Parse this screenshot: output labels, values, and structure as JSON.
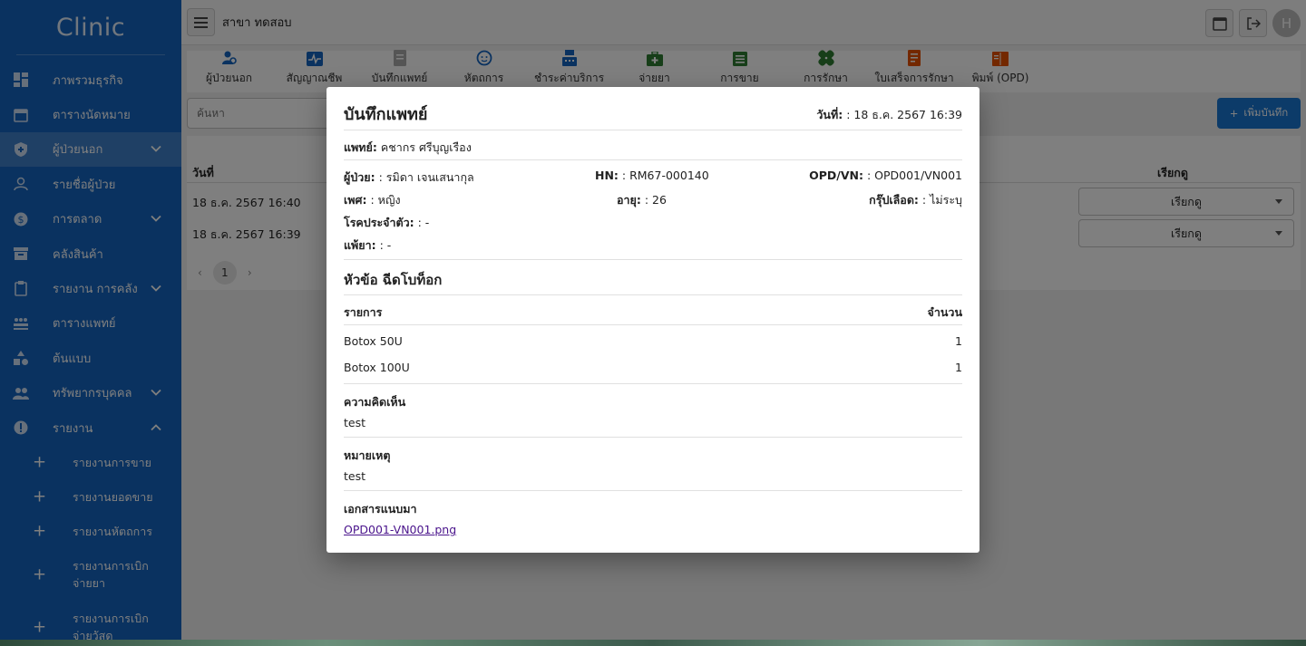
{
  "sidebar": {
    "brand": "Clinic",
    "items": [
      {
        "label": "ภาพรวมธุรกิจ",
        "icon": "dashboard-icon"
      },
      {
        "label": "ตารางนัดหมาย",
        "icon": "calendar-icon"
      },
      {
        "label": "ผู้ป่วยนอก",
        "icon": "shield-icon"
      },
      {
        "label": "รายชื่อผู้ป่วย",
        "icon": "people-icon"
      },
      {
        "label": "การตลาด",
        "icon": "dollar-icon"
      },
      {
        "label": "คลังสินค้า",
        "icon": "archive-icon"
      },
      {
        "label": "รายงาน การคลัง",
        "icon": "clipboard-icon"
      },
      {
        "label": "ตารางแพทย์",
        "icon": "group-icon"
      },
      {
        "label": "ต้นแบบ",
        "icon": "shapes-icon"
      },
      {
        "label": "ทรัพยากรบุคคล",
        "icon": "team-icon"
      },
      {
        "label": "รายงาน",
        "icon": "info-icon"
      }
    ],
    "sub_items": [
      {
        "label": "รายงานการขาย"
      },
      {
        "label": "รายงานยอดขาย"
      },
      {
        "label": "รายงานหัตถการ"
      },
      {
        "label": "รายงานการเบิกจ่ายยา"
      },
      {
        "label": "รายงานการเบิกจ่ายวัสดุ"
      }
    ]
  },
  "topbar": {
    "branch": "สาขา ทดสอบ",
    "avatar": "H"
  },
  "tabs": [
    {
      "label": "ผู้ป่วยนอก",
      "icon": "patient-search-icon",
      "color": "#1565c0"
    },
    {
      "label": "สัญญาณชีพ",
      "icon": "vitals-icon",
      "color": "#1565c0"
    },
    {
      "label": "บันทึกแพทย์",
      "icon": "doctor-note-icon",
      "color": "#aaaaaa"
    },
    {
      "label": "หัตถการ",
      "icon": "face-icon",
      "color": "#1565c0"
    },
    {
      "label": "ชำระค่าบริการ",
      "icon": "cashier-icon",
      "color": "#1565c0"
    },
    {
      "label": "จ่ายยา",
      "icon": "medkit-icon",
      "color": "#2e7d32"
    },
    {
      "label": "การขาย",
      "icon": "sales-icon",
      "color": "#2e7d32"
    },
    {
      "label": "การรักษา",
      "icon": "bandage-icon",
      "color": "#2e7d32"
    },
    {
      "label": "ใบเสร็จการรักษา",
      "icon": "receipt-icon",
      "color": "#e65100"
    },
    {
      "label": "พิมพ์ (OPD)",
      "icon": "book-icon",
      "color": "#e65100"
    }
  ],
  "search": {
    "placeholder": "ค้นหา"
  },
  "add_button": "เพิ่มบันทึก",
  "table": {
    "headers": {
      "date": "วันที่",
      "status": "เรียกดู"
    },
    "rows": [
      {
        "date": "18 ธ.ค. 2567 16:40",
        "action": "เรียกดู"
      },
      {
        "date": "18 ธ.ค. 2567 16:39",
        "action": "เรียกดู"
      }
    ],
    "page": "1"
  },
  "modal": {
    "title": "บันทึกแพทย์",
    "date_label": "วันที่:",
    "date_value": ": 18 ธ.ค. 2567 16:39",
    "doctor_label": "แพทย์:",
    "doctor_value": "คชากร ศรีบุญเรือง",
    "patient_label": "ผู้ป่วย:",
    "patient_value": ": รมิดา เจนเสนากุล",
    "hn_label": "HN:",
    "hn_value": ": RM67-000140",
    "opd_label": "OPD/VN:",
    "opd_value": ": OPD001/VN001",
    "sex_label": "เพศ:",
    "sex_value": ": หญิง",
    "age_label": "อายุ:",
    "age_value": ": 26",
    "blood_label": "กรุ๊ปเลือด:",
    "blood_value": ": ไม่ระบุ",
    "disease_label": "โรคประจำตัว:",
    "disease_value": ": -",
    "allergy_label": "แพ้ยา:",
    "allergy_value": ": -",
    "topic": "หัวข้อ ฉีดโบท็อก",
    "list_header_item": "รายการ",
    "list_header_qty": "จำนวน",
    "items": [
      {
        "name": "Botox 50U",
        "qty": "1"
      },
      {
        "name": "Botox 100U",
        "qty": "1"
      }
    ],
    "comment_label": "ความคิดเห็น",
    "comment_value": "test",
    "note_label": "หมายเหตุ",
    "note_value": "test",
    "attach_label": "เอกสารแนบมา",
    "attach_file": "OPD001-VN001.png"
  }
}
